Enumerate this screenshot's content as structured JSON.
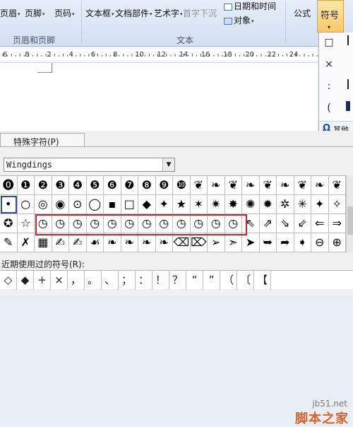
{
  "ribbon": {
    "header_footer": {
      "header_label": "页眉",
      "footer_label": "页脚",
      "page_number_label": "页码",
      "group_label": "页眉和页脚"
    },
    "text": {
      "textbox_label": "文本框",
      "docparts_label": "文档部件",
      "wordart_label": "艺术字",
      "dropcap_label": "首字下沉",
      "datetime_label": "日期和时间",
      "object_label": "对象",
      "group_label": "文本"
    },
    "formula_label": "公式",
    "symbol_label": "符号"
  },
  "ruler": {
    "numbers": [
      "6",
      "8",
      "2",
      "4",
      "6",
      "8",
      "10",
      "12",
      "14",
      "16",
      "18",
      "20",
      "22",
      "24"
    ]
  },
  "symbol_panel": {
    "cells": [
      "□",
      "",
      "×",
      "",
      ":",
      "",
      "(",
      ""
    ],
    "more_icon": "Ω",
    "more_label": "其他"
  },
  "dialog": {
    "tab_label": "特殊字符(P)",
    "font_value": "Wingdings",
    "grid_rows": [
      [
        "⓿",
        "❶",
        "❷",
        "❸",
        "❹",
        "❺",
        "❻",
        "❼",
        "❽",
        "❾",
        "❿",
        "❦",
        "❧",
        "❦",
        "❧",
        "❦",
        "❧",
        "❦",
        "❧",
        "❦"
      ],
      [
        "•",
        "○",
        "◎",
        "◉",
        "⊙",
        "◯",
        "▪",
        "□",
        "◆",
        "✦",
        "★",
        "✶",
        "✷",
        "✸",
        "✺",
        "✹",
        "✲",
        "✳",
        "✦",
        "✧"
      ],
      [
        "✪",
        "☆",
        "◷",
        "◷",
        "◷",
        "◷",
        "◷",
        "◷",
        "◷",
        "◷",
        "◷",
        "◷",
        "◷",
        "◷",
        "⇖",
        "⇗",
        "⇘",
        "⇙",
        "⇐",
        "⇒"
      ],
      [
        "✎",
        "✗",
        "▦",
        "✍",
        "✍",
        "☙",
        "❧",
        "❧",
        "❧",
        "❧",
        "⌫",
        "⌦",
        "➢",
        "➣",
        "➤",
        "➥",
        "➦",
        "➧",
        "⊖",
        "⊕"
      ]
    ],
    "recent_label": "近期使用过的符号(R):",
    "recent": [
      "◇",
      "◆",
      "+",
      "×",
      "，",
      "。",
      "、",
      "；",
      "：",
      "！",
      "？",
      "“",
      "”",
      "（",
      "〔",
      "【"
    ]
  },
  "watermark": {
    "site": "jb51.net",
    "brand": "脚本之家"
  },
  "colors": {
    "highlight": "#c0282d",
    "ribbon_active": "#f9c86a"
  }
}
